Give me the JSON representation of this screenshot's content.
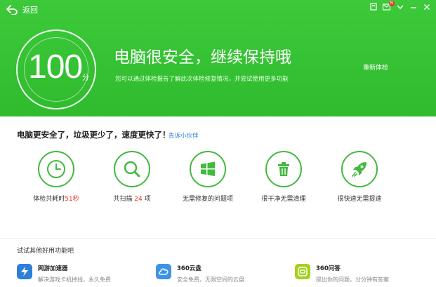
{
  "header": {
    "back_label": "返回",
    "badge": "N",
    "icons": [
      "skin-icon",
      "message-icon",
      "menu-icon",
      "minimize-icon",
      "close-icon"
    ]
  },
  "hero": {
    "score": "100",
    "score_unit": "分",
    "title": "电脑很安全，继续保持哦",
    "subtitle": "您可以通过体检报告了解此次体检修复情况，并尝试使用更多功能",
    "recheck_label": "重新体检",
    "bg_color": "#33c032"
  },
  "summary": {
    "headline": "电脑更安全了，垃圾更少了，速度更快了！",
    "share_link": "告诉小伙伴"
  },
  "stats": [
    {
      "icon": "clock-icon",
      "prefix": "体检共耗时",
      "value": "51秒",
      "suffix": ""
    },
    {
      "icon": "magnifier-icon",
      "prefix": "共扫描 ",
      "value": "24",
      "suffix": " 项"
    },
    {
      "icon": "windows-icon",
      "prefix": "无需修复的问题项",
      "value": "",
      "suffix": ""
    },
    {
      "icon": "trash-icon",
      "prefix": "很干净无需清理",
      "value": "",
      "suffix": ""
    },
    {
      "icon": "rocket-icon",
      "prefix": "很快速无需提速",
      "value": "",
      "suffix": ""
    }
  ],
  "features_title": "试试其他好用功能吧",
  "features": [
    {
      "icon": "lightning-icon",
      "name": "网游加速器",
      "desc": "解决游戏卡机掉线，永久免费"
    },
    {
      "icon": "cloud-icon",
      "name": "360云盘",
      "desc": "安全免费，无限空间的云盘"
    },
    {
      "icon": "question-icon",
      "name": "360问答",
      "desc": "提出你的问题，分分钟有答案"
    }
  ],
  "colors": {
    "accent": "#42b93f",
    "highlight": "#e53b2c",
    "link": "#2c7fd6"
  }
}
